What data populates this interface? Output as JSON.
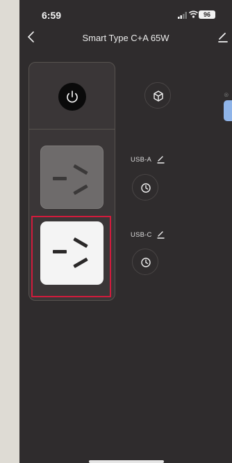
{
  "status": {
    "time": "6:59",
    "battery": "96"
  },
  "header": {
    "title": "Smart Type C+A 65W"
  },
  "ports": [
    {
      "label": "USB-A",
      "state": "off"
    },
    {
      "label": "USB-C",
      "state": "on"
    }
  ],
  "colors": {
    "background": "#2f2c2d",
    "outlet_on": "#f4f4f4",
    "outlet_off": "#6e6b6b",
    "highlight": "#d21b3c"
  },
  "icons": {
    "power": "power-icon",
    "scene": "cube-icon",
    "timer": "clock-icon",
    "edit": "pencil-icon",
    "back": "chevron-left-icon"
  }
}
